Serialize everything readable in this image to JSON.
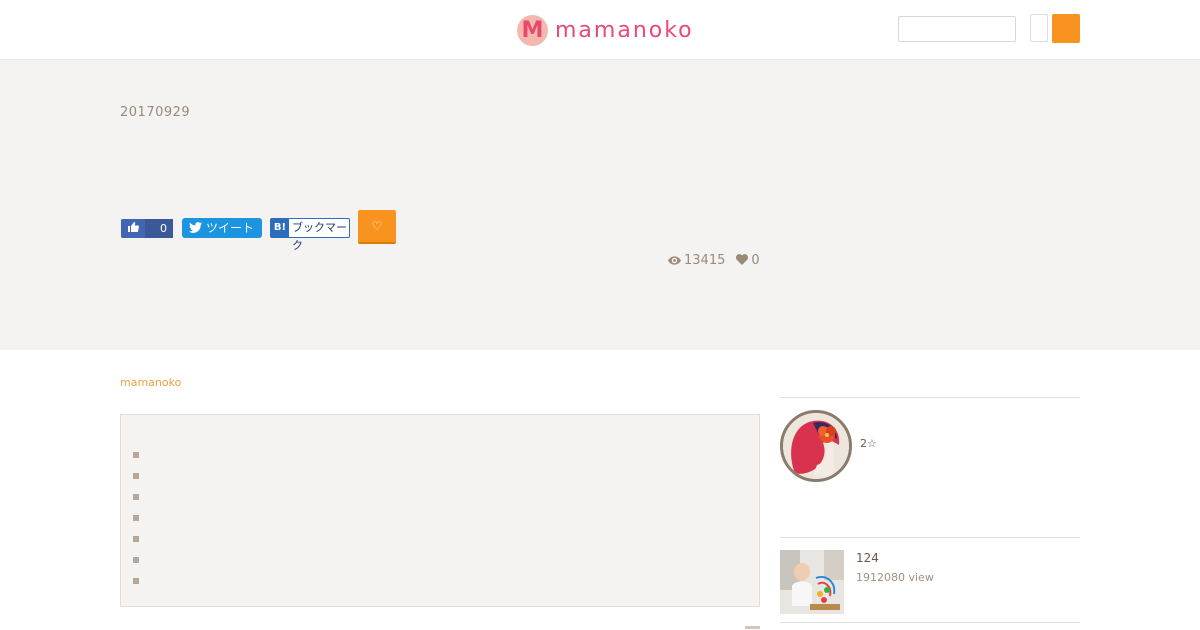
{
  "header": {
    "logo_badge": "M",
    "logo_text": "mamanoko",
    "search_placeholder": ""
  },
  "hero": {
    "date": "20170929",
    "share": {
      "facebook_count": "0",
      "twitter_label": "ツイート",
      "hatena_badge": "B!",
      "hatena_label": "ブックマーク",
      "favorite_icon": "♡"
    },
    "stats": {
      "views": "13415",
      "likes": "0"
    }
  },
  "content": {
    "breadcrumb": "mamanoko",
    "toc_item_count": 7
  },
  "sidebar": {
    "author_name": "2☆",
    "post_count": "124",
    "post_views": "1912080 view"
  },
  "colors": {
    "accent": "#f7931e",
    "logo": "#e8497a",
    "hero_bg": "#f5f3f1",
    "facebook": "#3b5998",
    "twitter": "#1b95e0",
    "hatena": "#2c6ebd"
  },
  "icons": {
    "views": "eye-icon",
    "likes": "heart-icon",
    "facebook": "thumbs-up-icon",
    "twitter": "twitter-bird-icon",
    "favorite": "heart-outline-icon"
  }
}
